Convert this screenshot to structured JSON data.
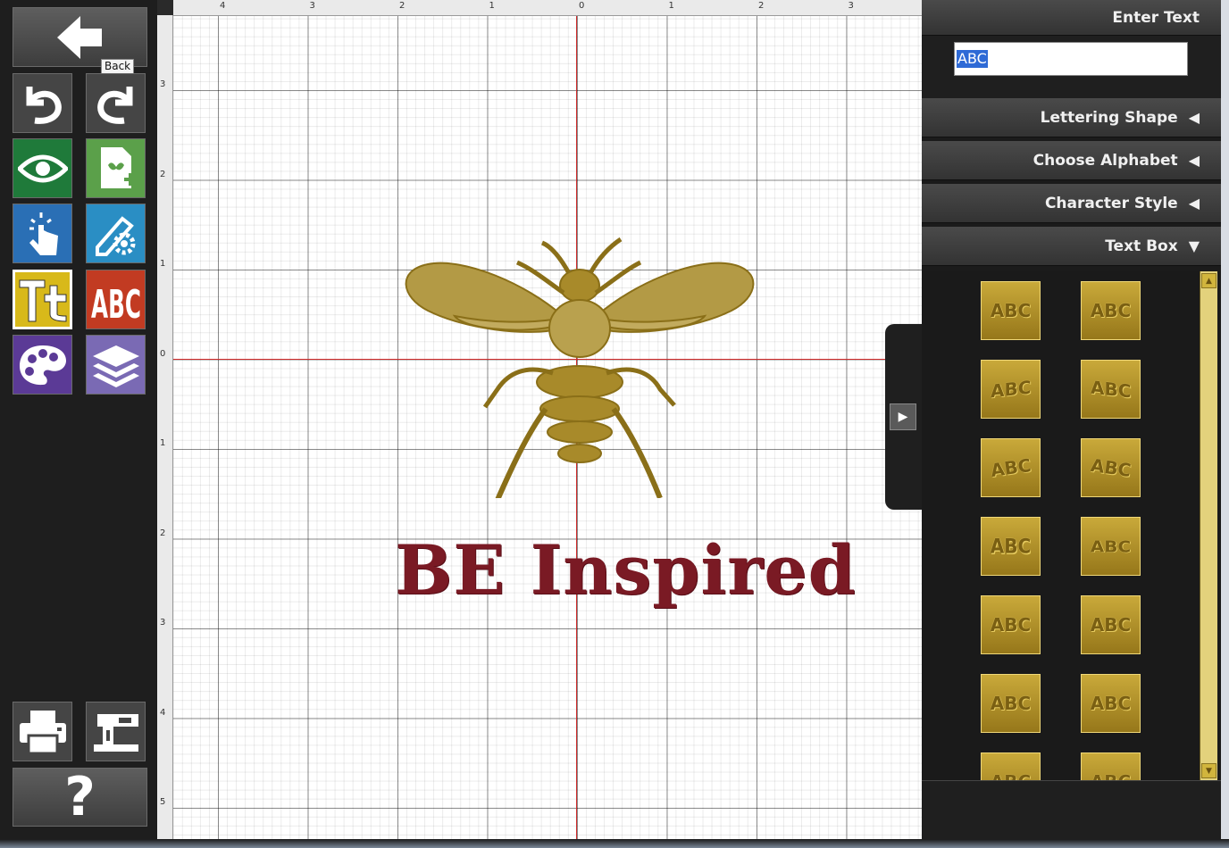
{
  "toolbar": {
    "back_tooltip": "Back",
    "help_label": "?",
    "buttons": [
      {
        "name": "undo",
        "icon": "undo-icon",
        "color": "#4a4a4a"
      },
      {
        "name": "redo",
        "icon": "redo-icon",
        "color": "#4a4a4a"
      },
      {
        "name": "preview",
        "icon": "eye-icon",
        "color": "#1f7a3a"
      },
      {
        "name": "add-design",
        "icon": "add-design-icon",
        "color": "#5ba04a"
      },
      {
        "name": "select",
        "icon": "hand-pointer-icon",
        "color": "#2a6fb5"
      },
      {
        "name": "edit-tools",
        "icon": "edit-gear-icon",
        "color": "#2a8ec4"
      },
      {
        "name": "text",
        "icon": "text-icon",
        "color": "#d8b91a"
      },
      {
        "name": "monogram",
        "icon": "monogram-icon",
        "color": "#c23b22"
      },
      {
        "name": "colors",
        "icon": "palette-icon",
        "color": "#5b3a96"
      },
      {
        "name": "layers",
        "icon": "layers-icon",
        "color": "#7a6ab4"
      },
      {
        "name": "print",
        "icon": "printer-icon",
        "color": "#4a4a4a"
      },
      {
        "name": "send-to-machine",
        "icon": "sewing-machine-icon",
        "color": "#4a4a4a"
      }
    ]
  },
  "ruler": {
    "top": [
      "4",
      "3",
      "2",
      "1",
      "0",
      "1",
      "2",
      "3"
    ],
    "left": [
      "3",
      "2",
      "1",
      "0",
      "1",
      "2",
      "3",
      "4",
      "5"
    ]
  },
  "design": {
    "text": "BE Inspired",
    "text_color": "#7a1a24",
    "motif_color": "#a88a2a"
  },
  "panel": {
    "enter_text_title": "Enter Text",
    "input_value": "ABC",
    "sections": [
      {
        "label": "Lettering Shape",
        "state": "collapsed"
      },
      {
        "label": "Choose Alphabet",
        "state": "collapsed"
      },
      {
        "label": "Character Style",
        "state": "collapsed"
      },
      {
        "label": "Text Box",
        "state": "expanded"
      }
    ],
    "arrow_collapsed": "◀",
    "arrow_expanded": "▼",
    "tiles": [
      "ABC",
      "ABC",
      "ABC",
      "ABC",
      "ABC",
      "ABC",
      "ABC",
      "ABC",
      "ABC",
      "ABC",
      "ABC",
      "ABC",
      "ABC",
      "ABC"
    ]
  }
}
